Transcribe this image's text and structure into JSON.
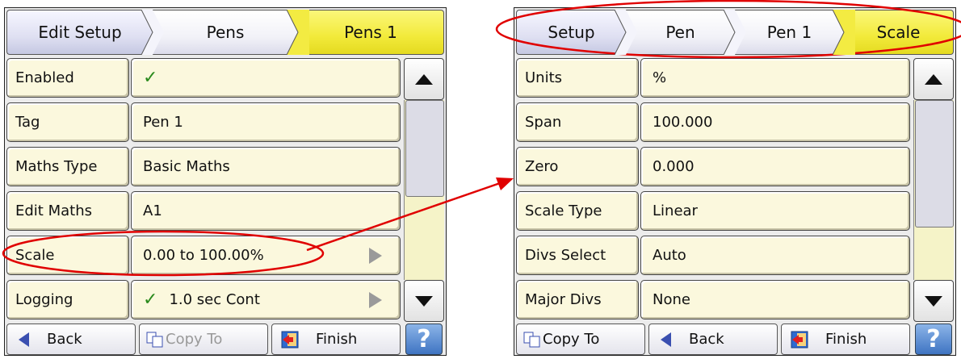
{
  "left_panel": {
    "breadcrumb": [
      "Edit Setup",
      "Pens",
      "Pens 1"
    ],
    "rows": [
      {
        "label": "Enabled",
        "value": "",
        "check": true,
        "arrow": false
      },
      {
        "label": "Tag",
        "value": "Pen 1",
        "check": false,
        "arrow": false
      },
      {
        "label": "Maths Type",
        "value": "Basic Maths",
        "check": false,
        "arrow": false
      },
      {
        "label": "Edit Maths",
        "value": "A1",
        "check": false,
        "arrow": false
      },
      {
        "label": "Scale",
        "value": "0.00 to 100.00%",
        "check": false,
        "arrow": true
      },
      {
        "label": "Logging",
        "value": "1.0 sec Cont",
        "check": true,
        "arrow": true
      }
    ],
    "buttons": {
      "back": "Back",
      "copy_to": "Copy To",
      "finish": "Finish",
      "help": "?"
    }
  },
  "right_panel": {
    "breadcrumb": [
      "Setup",
      "Pen",
      "Pen 1",
      "Scale"
    ],
    "rows": [
      {
        "label": "Units",
        "value": "%"
      },
      {
        "label": "Span",
        "value": "100.000"
      },
      {
        "label": "Zero",
        "value": "0.000"
      },
      {
        "label": "Scale Type",
        "value": "Linear"
      },
      {
        "label": "Divs Select",
        "value": "Auto"
      },
      {
        "label": "Major Divs",
        "value": "None"
      }
    ],
    "buttons": {
      "copy_to": "Copy To",
      "back": "Back",
      "finish": "Finish",
      "help": "?"
    }
  },
  "colors": {
    "highlight": "#f2ea3a",
    "row_bg": "#fbf8dd",
    "annotation": "#e00000",
    "check": "#2a8a1d"
  },
  "icons": [
    "check-icon",
    "play-arrow-icon",
    "scroll-up-icon",
    "scroll-down-icon",
    "back-arrow-icon",
    "copy-icon",
    "finish-icon",
    "help-icon"
  ]
}
